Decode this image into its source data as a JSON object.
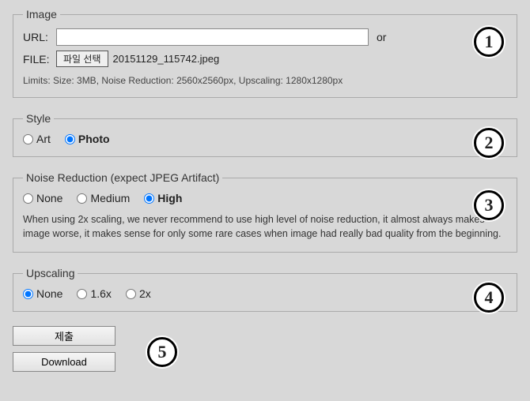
{
  "image": {
    "legend": "Image",
    "url_label": "URL:",
    "url_value": "",
    "or": "or",
    "file_label": "FILE:",
    "file_button": "파일 선택",
    "file_name": "20151129_115742.jpeg",
    "limits": "Limits: Size: 3MB, Noise Reduction: 2560x2560px, Upscaling: 1280x1280px",
    "badge": "1"
  },
  "style": {
    "legend": "Style",
    "options": {
      "art": "Art",
      "photo": "Photo"
    },
    "selected": "photo",
    "badge": "2"
  },
  "noise": {
    "legend": "Noise Reduction (expect JPEG Artifact)",
    "options": {
      "none": "None",
      "medium": "Medium",
      "high": "High"
    },
    "selected": "high",
    "desc": "When using 2x scaling, we never recommend to use high level of noise reduction, it almost always makes image worse, it makes sense for only some rare cases when image had really bad quality from the beginning.",
    "badge": "3"
  },
  "upscaling": {
    "legend": "Upscaling",
    "options": {
      "none": "None",
      "x16": "1.6x",
      "x2": "2x"
    },
    "selected": "none",
    "badge": "4"
  },
  "actions": {
    "submit": "제출",
    "download": "Download",
    "badge": "5"
  }
}
